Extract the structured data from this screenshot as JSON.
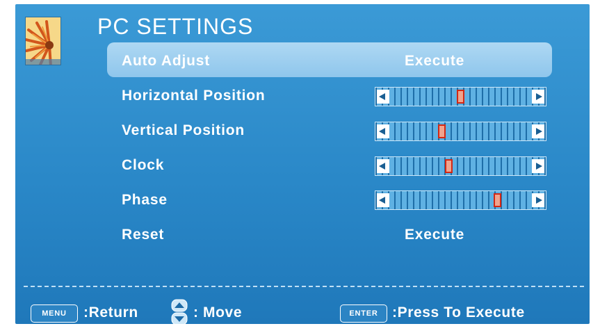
{
  "header": {
    "title": "PC SETTINGS"
  },
  "logo_icon": "flower-picture-icon",
  "rows": [
    {
      "label": "Auto Adjust",
      "value": "Execute",
      "type": "action",
      "selected": true
    },
    {
      "label": "Horizontal Position",
      "type": "slider",
      "level": 0.5
    },
    {
      "label": "Vertical Position",
      "type": "slider",
      "level": 0.36
    },
    {
      "label": "Clock",
      "type": "slider",
      "level": 0.41
    },
    {
      "label": "Phase",
      "type": "slider",
      "level": 0.78
    },
    {
      "label": "Reset",
      "value": "Execute",
      "type": "action",
      "selected": false
    }
  ],
  "footer": {
    "menu_key": "MENU",
    "menu_text": ":Return",
    "move_icon": "up-down-arrows-icon",
    "move_text": ": Move",
    "enter_key": "ENTER",
    "enter_text": ":Press To Execute"
  },
  "colors": {
    "background": "#2a88c8",
    "highlight": "#9ecff0",
    "slider_thumb_border": "#d22814"
  }
}
